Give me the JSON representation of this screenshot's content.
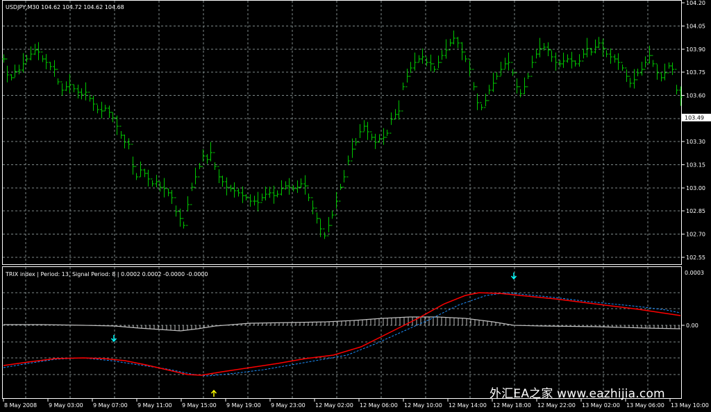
{
  "price_pane": {
    "header": "USDJPY,M30  104.62 104.72 104.62 104.68",
    "price_labels": [
      "104.20",
      "104.05",
      "103.90",
      "103.75",
      "103.60",
      "103.45",
      "103.30",
      "103.15",
      "103.00",
      "102.85",
      "102.70",
      "102.55"
    ],
    "last_price": "103.49"
  },
  "indicator_pane": {
    "header": "TRIX index | Period: 13, Signal Period: 8 |  0.0002 0.0002 -0.0000 -0.0000",
    "scale_labels": [
      "0.0003",
      "0.00"
    ],
    "series_colors": {
      "trix": "#ff0000",
      "signal": "#1e90ff",
      "histogram": "#c0c0c0"
    }
  },
  "time_labels": [
    "8 May 2008",
    "9 May 03:00",
    "9 May 07:00",
    "9 May 11:00",
    "9 May 15:00",
    "9 May 19:00",
    "9 May 23:00",
    "12 May 02:00",
    "12 May 06:00",
    "12 May 10:00",
    "12 May 14:00",
    "12 May 18:00",
    "12 May 22:00",
    "13 May 02:00",
    "13 May 06:00",
    "13 May 10:00"
  ],
  "arrows": [
    {
      "icon": "arrow-down-icon",
      "color": "#00ffff"
    },
    {
      "icon": "arrow-up-icon",
      "color": "#ffff00"
    },
    {
      "icon": "arrow-down-icon",
      "color": "#00ffff"
    }
  ],
  "colors": {
    "bars": "#00c800",
    "grid": "#7f8a8a",
    "frame": "#ffffff"
  },
  "watermark": "外汇EA之家 www.eazhijia.com"
}
